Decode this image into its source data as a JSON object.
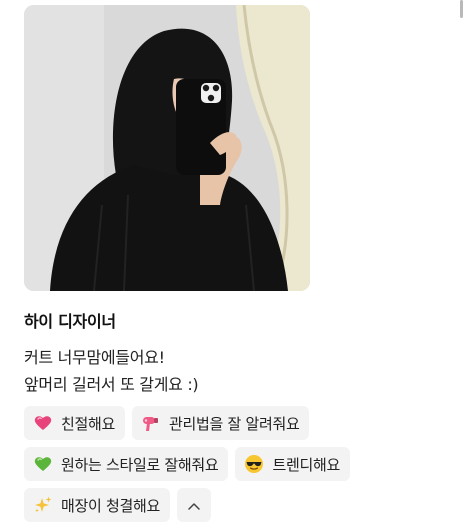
{
  "review": {
    "designer_name": "하이 디자이너",
    "text_lines": [
      "커트 너무맘에들어요!",
      "앞머리 길러서 또 갈게요 :)"
    ],
    "photo_icon": "mirror-selfie-photo"
  },
  "tags": [
    {
      "emoji_icon": "heart-icon",
      "label": "친절해요"
    },
    {
      "emoji_icon": "hair-dryer-icon",
      "label": "관리법을 잘 알려줘요"
    },
    {
      "emoji_icon": "green-heart-icon",
      "label": "원하는 스타일로 잘해줘요"
    },
    {
      "emoji_icon": "sunglasses-face-icon",
      "label": "트렌디해요"
    },
    {
      "emoji_icon": "sparkles-icon",
      "label": "매장이 청결해요"
    }
  ],
  "collapse": {
    "icon": "chevron-up-icon"
  },
  "colors": {
    "tag_background": "#f3f3f3",
    "text": "#222222"
  }
}
